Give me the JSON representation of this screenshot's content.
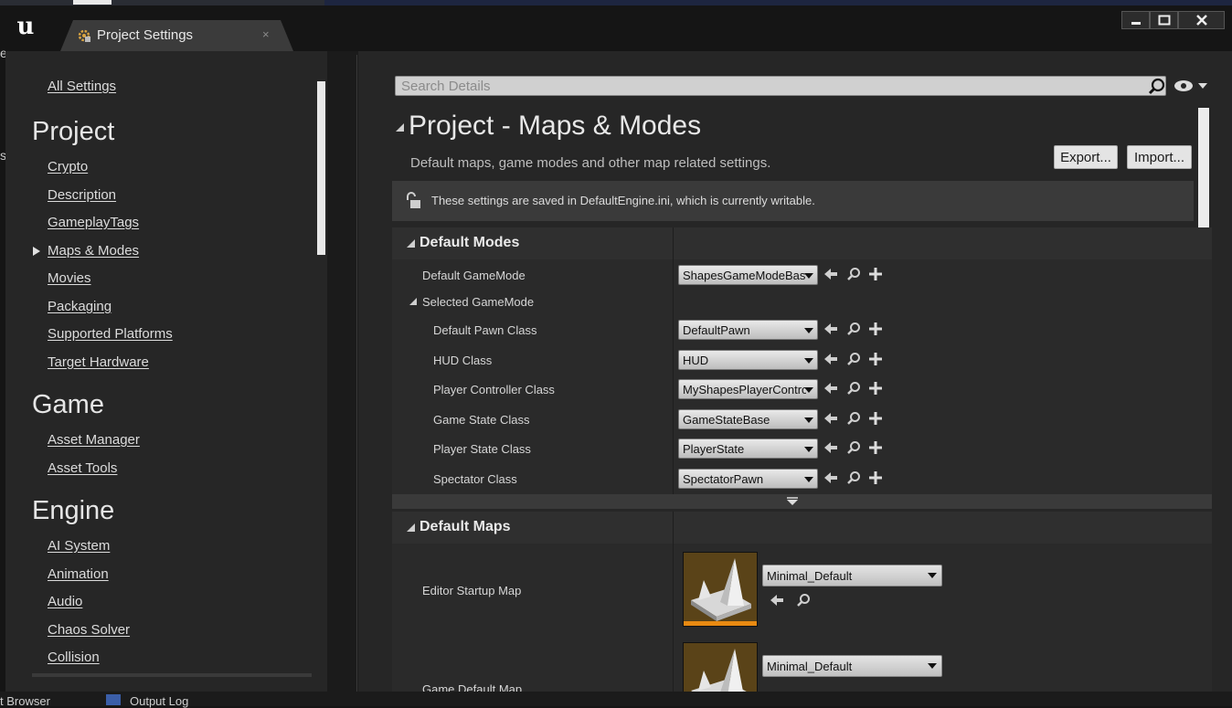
{
  "window": {
    "tab_title": "Project Settings",
    "tab_close": "×"
  },
  "background": {
    "left_edge_chars": [
      "e",
      "s"
    ],
    "bottom_tabs": [
      "t Browser",
      "Output Log"
    ]
  },
  "sidebar": {
    "all_settings": "All Settings",
    "categories": [
      {
        "title": "Project",
        "items": [
          "Crypto",
          "Description",
          "GameplayTags",
          "Maps & Modes",
          "Movies",
          "Packaging",
          "Supported Platforms",
          "Target Hardware"
        ]
      },
      {
        "title": "Game",
        "items": [
          "Asset Manager",
          "Asset Tools"
        ]
      },
      {
        "title": "Engine",
        "items": [
          "AI System",
          "Animation",
          "Audio",
          "Chaos Solver",
          "Collision"
        ]
      }
    ],
    "selected_item": "Maps & Modes"
  },
  "details": {
    "search_placeholder": "Search Details",
    "title": "Project - Maps & Modes",
    "subtitle": "Default maps, game modes and other map related settings.",
    "export_label": "Export...",
    "import_label": "Import...",
    "notice": "These settings are saved in DefaultEngine.ini, which is currently writable.",
    "default_modes": {
      "header": "Default Modes",
      "default_gamemode_label": "Default GameMode",
      "default_gamemode_value": "ShapesGameModeBase",
      "selected_gamemode_label": "Selected GameMode",
      "rows": [
        {
          "label": "Default Pawn Class",
          "value": "DefaultPawn"
        },
        {
          "label": "HUD Class",
          "value": "HUD"
        },
        {
          "label": "Player Controller Class",
          "value": "MyShapesPlayerController"
        },
        {
          "label": "Game State Class",
          "value": "GameStateBase"
        },
        {
          "label": "Player State Class",
          "value": "PlayerState"
        },
        {
          "label": "Spectator Class",
          "value": "SpectatorPawn"
        }
      ]
    },
    "default_maps": {
      "header": "Default Maps",
      "editor_startup_label": "Editor Startup Map",
      "editor_startup_value": "Minimal_Default",
      "game_default_label": "Game Default Map",
      "game_default_value": "Minimal_Default"
    }
  },
  "colors": {
    "thumbnail_accent": "#e98a12",
    "panel": "#262626"
  }
}
